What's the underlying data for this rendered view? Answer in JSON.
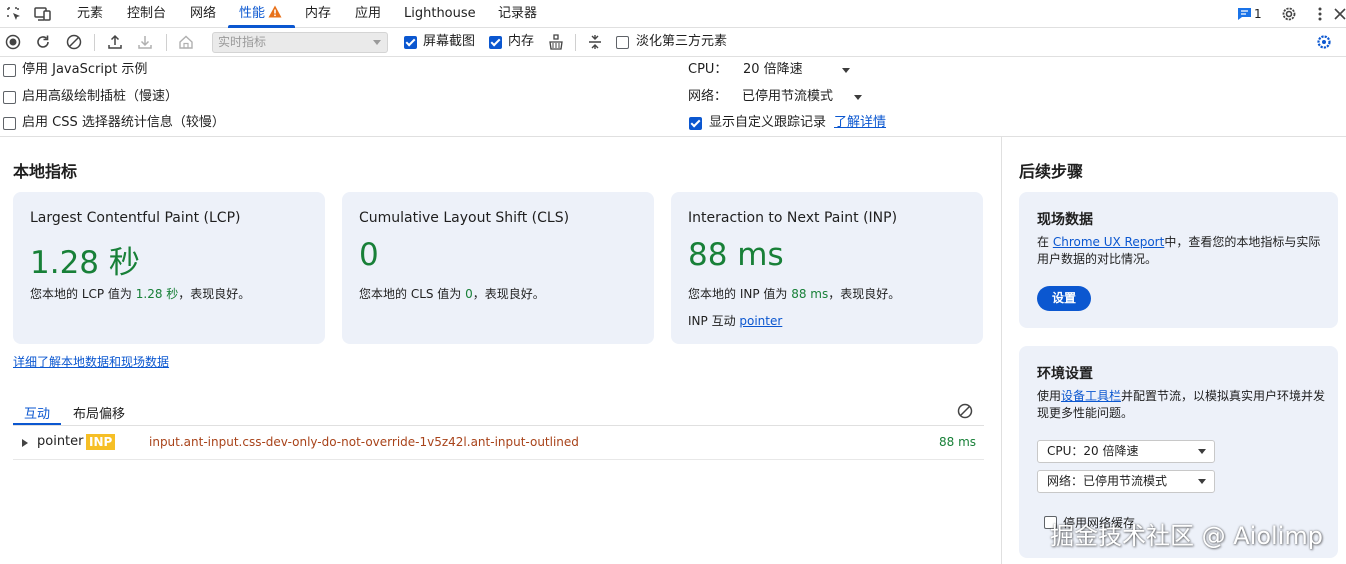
{
  "tabs": [
    {
      "label": "元素"
    },
    {
      "label": "控制台"
    },
    {
      "label": "网络"
    },
    {
      "label": "性能"
    },
    {
      "label": "内存"
    },
    {
      "label": "应用"
    },
    {
      "label": "Lighthouse"
    },
    {
      "label": "记录器"
    }
  ],
  "header": {
    "message_count": "1"
  },
  "toolbar": {
    "select_placeholder": "实时指标",
    "screenshots_label": "屏幕截图",
    "memory_label": "内存",
    "dim_third_party_label": "淡化第三方元素",
    "screenshots_checked": true,
    "memory_checked": true,
    "dim_third_party_checked": false
  },
  "settings": {
    "disable_js_samples": "停用 JavaScript 示例",
    "advanced_paint": "启用高级绘制插桩（慢速）",
    "css_selector_stats": "启用 CSS 选择器统计信息（较慢）",
    "cpu_label": "CPU：",
    "cpu_value": "20 倍降速",
    "network_label": "网络：",
    "network_value": "已停用节流模式",
    "custom_tracks": "显示自定义跟踪记录",
    "learn_more": "了解详情"
  },
  "local_metrics": {
    "title": "本地指标",
    "cards": [
      {
        "title": "Largest Contentful Paint (LCP)",
        "value": "1.28 秒",
        "desc_prefix": "您本地的 LCP 值为 ",
        "desc_value": "1.28 秒",
        "desc_suffix": "，表现良好。"
      },
      {
        "title": "Cumulative Layout Shift (CLS)",
        "value": "0",
        "desc_prefix": "您本地的 CLS 值为 ",
        "desc_value": "0",
        "desc_suffix": "，表现良好。"
      },
      {
        "title": "Interaction to Next Paint (INP)",
        "value": "88 ms",
        "desc_prefix": "您本地的 INP 值为 ",
        "desc_value": "88 ms",
        "desc_suffix": "，表现良好。",
        "interaction_label": "INP 互动 ",
        "interaction_link": "pointer"
      }
    ],
    "details_link": "详细了解本地数据和现场数据",
    "subtabs": [
      "互动",
      "布局偏移"
    ],
    "interaction_row": {
      "type": "pointer",
      "badge": "INP",
      "selector": "input.ant-input.css-dev-only-do-not-override-1v5z42l.ant-input-outlined",
      "duration": "88 ms"
    }
  },
  "next_steps": {
    "title": "后续步骤",
    "field_data": {
      "title": "现场数据",
      "text_prefix": "在 ",
      "link": "Chrome UX Report",
      "text_suffix": "中，查看您的本地指标与实际用户数据的对比情况。",
      "button": "设置"
    },
    "environment": {
      "title": "环境设置",
      "text_prefix": "使用",
      "link": "设备工具栏",
      "text_suffix": "并配置节流，以模拟真实用户环境并发现更多性能问题。",
      "cpu_select": "CPU：20 倍降速",
      "network_select": "网络：已停用节流模式",
      "disable_cache": "停用网络缓存"
    }
  },
  "watermark": "掘金技术社区 @ Aiolimp",
  "colors": {
    "accent": "#0b57d0",
    "good": "#188038",
    "card_bg": "#edf1f9",
    "selector": "#a8431a",
    "inp_badge": "#f6bf26"
  }
}
